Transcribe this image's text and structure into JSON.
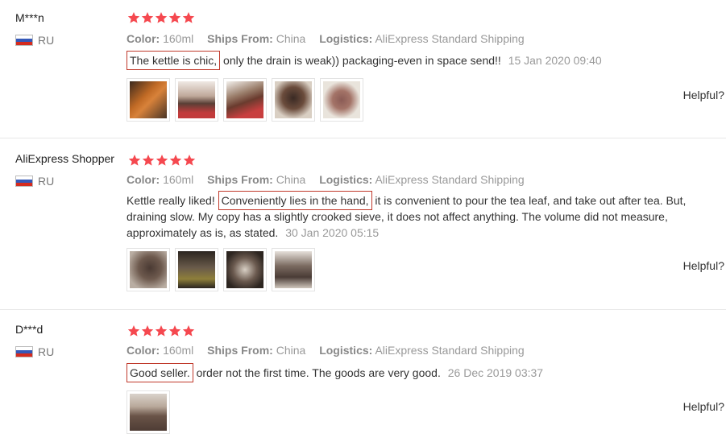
{
  "reviews": [
    {
      "user": "M***n",
      "country": "RU",
      "color_label": "Color:",
      "color_value": "160ml",
      "ships_label": "Ships From:",
      "ships_value": "China",
      "logistics_label": "Logistics:",
      "logistics_value": "AliExpress Standard Shipping",
      "text_before": "",
      "text_highlight": "The kettle is chic,",
      "text_after": "only the drain is weak)) packaging-even in space send!!",
      "date": "15 Jan 2020 09:40",
      "helpful_label": "Helpful?",
      "rating": 5
    },
    {
      "user": "AliExpress Shopper",
      "country": "RU",
      "color_label": "Color:",
      "color_value": "160ml",
      "ships_label": "Ships From:",
      "ships_value": "China",
      "logistics_label": "Logistics:",
      "logistics_value": "AliExpress Standard Shipping",
      "text_before": "Kettle really liked!",
      "text_highlight": "Conveniently lies in the hand,",
      "text_after": "it is convenient to pour the tea leaf, and take out after tea. But, draining slow. My copy has a slightly crooked sieve, it does not affect anything. The volume did not measure, approximately as is, as stated.",
      "date": "30 Jan 2020 05:15",
      "helpful_label": "Helpful?",
      "rating": 5
    },
    {
      "user": "D***d",
      "country": "RU",
      "color_label": "Color:",
      "color_value": "160ml",
      "ships_label": "Ships From:",
      "ships_value": "China",
      "logistics_label": "Logistics:",
      "logistics_value": "AliExpress Standard Shipping",
      "text_before": "",
      "text_highlight": "Good seller.",
      "text_after": "order not the first time. The goods are very good.",
      "date": "26 Dec 2019 03:37",
      "helpful_label": "Helpful?",
      "rating": 5
    }
  ],
  "colors": {
    "star": "#f5484f",
    "highlight_border": "#c0392b",
    "meta_text": "#999999"
  }
}
